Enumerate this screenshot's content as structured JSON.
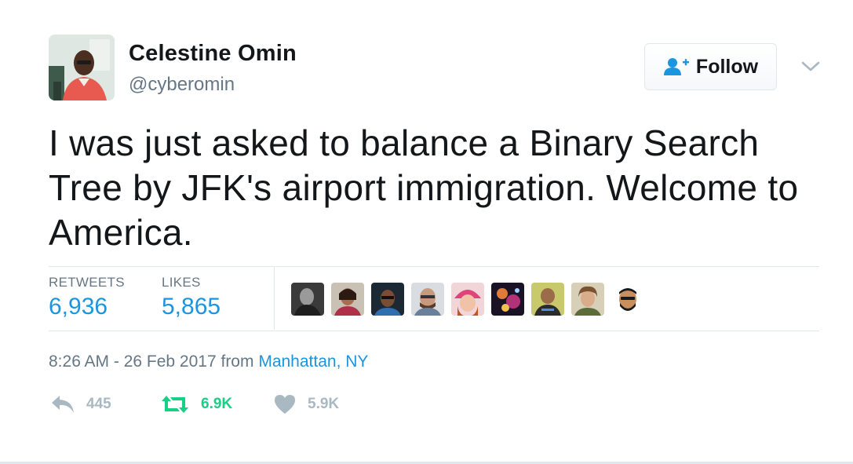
{
  "author": {
    "name": "Celestine Omin",
    "handle": "@cyberomin"
  },
  "follow_button": {
    "label": "Follow",
    "icon": "add-user-icon"
  },
  "menu_icon": "chevron-down-icon",
  "tweet": {
    "text": "I was just asked to balance a Binary Search Tree by JFK's airport immigration. Welcome to America."
  },
  "stats": {
    "retweets_label": "RETWEETS",
    "retweets_value": "6,936",
    "likes_label": "LIKES",
    "likes_value": "5,865"
  },
  "likers_count_shown": 9,
  "meta": {
    "timestamp": "8:26 AM - 26 Feb 2017",
    "from_word": "from",
    "location": "Manhattan, NY"
  },
  "actions": {
    "reply_count": "445",
    "retweet_count": "6.9K",
    "like_count": "5.9K"
  },
  "colors": {
    "link": "#1b95e0",
    "muted": "#657786",
    "retweet": "#19cf86",
    "icon_gray": "#aab8c2",
    "divider": "#e1e8ed"
  }
}
